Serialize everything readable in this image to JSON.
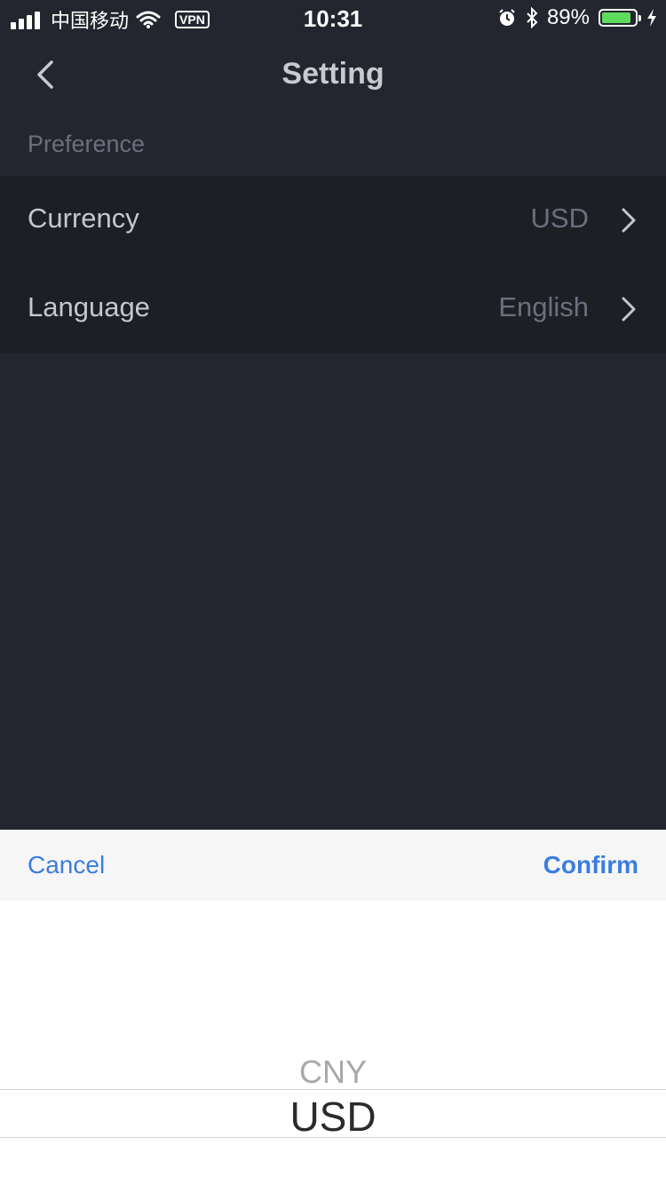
{
  "status_bar": {
    "carrier": "中国移动",
    "vpn": "VPN",
    "time": "10:31",
    "battery_percent": "89%",
    "battery_level": 0.89,
    "battery_color": "#5fdc5f"
  },
  "nav": {
    "title": "Setting"
  },
  "section": {
    "header": "Preference"
  },
  "settings": {
    "currency": {
      "label": "Currency",
      "value": "USD"
    },
    "language": {
      "label": "Language",
      "value": "English"
    }
  },
  "picker": {
    "cancel_label": "Cancel",
    "confirm_label": "Confirm",
    "options": [
      "CNY",
      "USD"
    ],
    "selected": "USD",
    "accent_color": "#3b7de0"
  }
}
